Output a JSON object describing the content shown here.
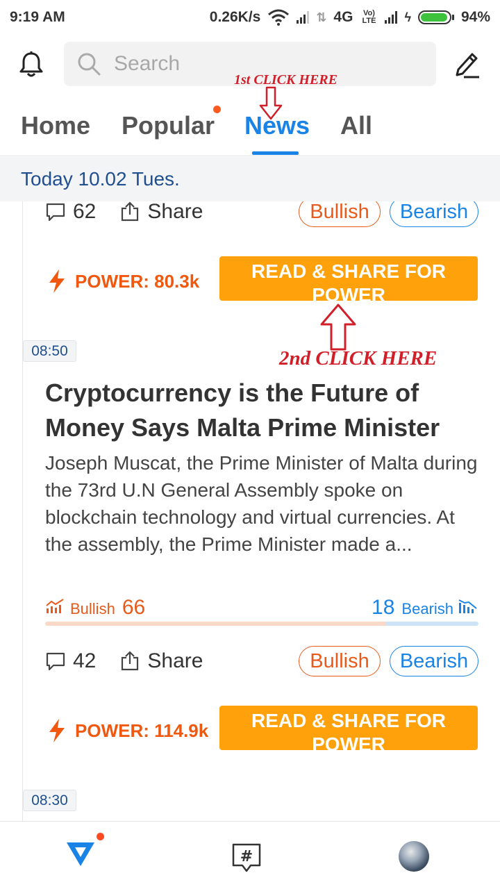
{
  "status_bar": {
    "time": "9:19 AM",
    "speed": "0.26K/s",
    "network": "4G",
    "volte": "Vo) LTE",
    "battery": "94%",
    "battery_level": 0.94
  },
  "search": {
    "placeholder": "Search"
  },
  "tabs": [
    {
      "label": "Home",
      "active": false
    },
    {
      "label": "Popular",
      "active": false,
      "has_dot": true
    },
    {
      "label": "News",
      "active": true
    },
    {
      "label": "All",
      "active": false
    }
  ],
  "date_header": "Today 10.02 Tues.",
  "annotations": {
    "first": "1st CLICK HERE",
    "second": "2nd CLICK HERE"
  },
  "items": [
    {
      "comments": "62",
      "share_label": "Share",
      "bullish_label": "Bullish",
      "bearish_label": "Bearish",
      "power": "POWER: 80.3k",
      "read_button": "READ & SHARE FOR POWER"
    },
    {
      "time": "08:50",
      "headline": "Cryptocurrency is the Future of Money Says Malta Prime Minister",
      "summary": "Joseph Muscat, the Prime Minister of Malta during the 73rd U.N General Assembly spoke on blockchain technology and virtual currencies. At the assembly, the Prime Minister made a...",
      "sentiment": {
        "bullish_label": "Bullish",
        "bullish_count": "66",
        "bearish_count": "18",
        "bearish_label": "Bearish",
        "bullish_ratio": 0.786
      },
      "comments": "42",
      "share_label": "Share",
      "bullish_label": "Bullish",
      "bearish_label": "Bearish",
      "power": "POWER: 114.9k",
      "read_button": "READ & SHARE FOR POWER"
    },
    {
      "time": "08:30"
    }
  ],
  "colors": {
    "accent_blue": "#1a83e6",
    "bullish_orange": "#e75a1c",
    "button_orange": "#ffa10a",
    "annotation_red": "#d11f2a"
  },
  "icons": [
    "bell-icon",
    "search-icon",
    "edit-icon",
    "comment-icon",
    "share-icon",
    "bolt-icon",
    "bullish-trend-icon",
    "bearish-trend-icon",
    "home-logo-icon",
    "hashtag-icon"
  ]
}
